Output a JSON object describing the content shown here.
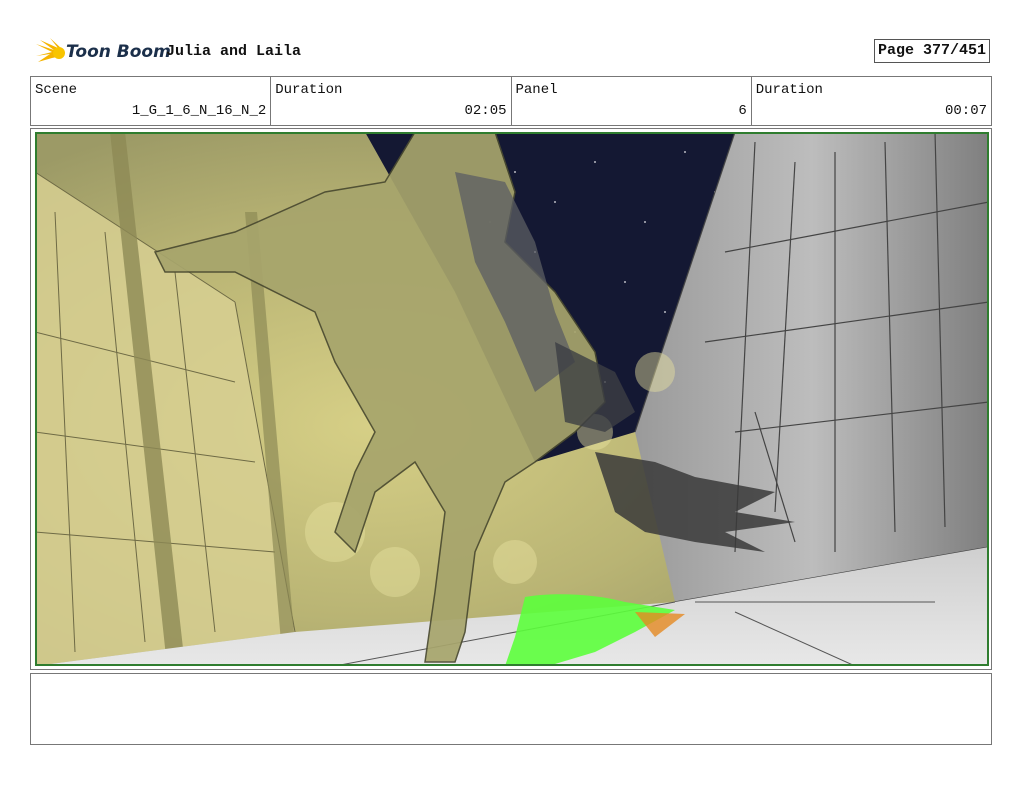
{
  "header": {
    "logo_text": "Toon Boom",
    "project_title": "Julia and Laila",
    "page_label": "Page 377/451"
  },
  "info": {
    "scene_label": "Scene",
    "scene_value": "1_G_1_6_N_16_N_2",
    "scene_duration_label": "Duration",
    "scene_duration_value": "02:05",
    "panel_label": "Panel",
    "panel_value": "6",
    "panel_duration_label": "Duration",
    "panel_duration_value": "00:07"
  },
  "colors": {
    "logo_accent": "#f5b400",
    "panel_border": "#2f7d2f",
    "night_sky": "#141833",
    "haze": "#bfbd7a",
    "highlight_green": "#5cff3c"
  },
  "notes": ""
}
